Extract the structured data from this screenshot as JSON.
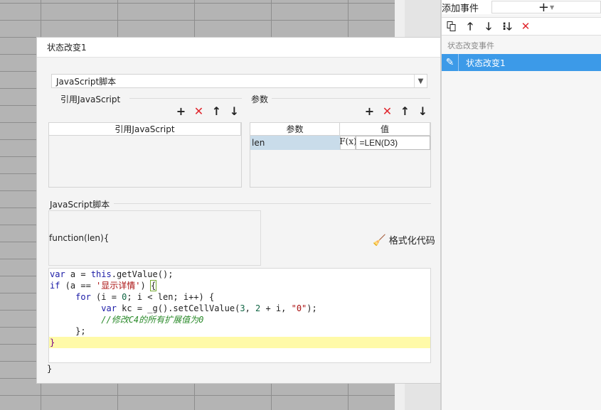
{
  "right_panel": {
    "title": "添加事件",
    "add_icon": "+",
    "caption": "状态改变事件",
    "items": [
      {
        "label": "状态改变1",
        "selected": true
      }
    ]
  },
  "dialog": {
    "title": "状态改变1",
    "script_type": "JavaScript脚本",
    "ref_section": {
      "title": "引用JavaScript",
      "column": "引用JavaScript"
    },
    "param_section": {
      "title": "参数",
      "columns": [
        "参数",
        "值"
      ],
      "rows": [
        {
          "name": "len",
          "fx": "F(x)",
          "value": "=LEN(D3)"
        }
      ]
    },
    "script_section": {
      "title": "JavaScript脚本",
      "function_header": "function(len){",
      "format_label": "格式化代码",
      "closing": "}"
    }
  }
}
